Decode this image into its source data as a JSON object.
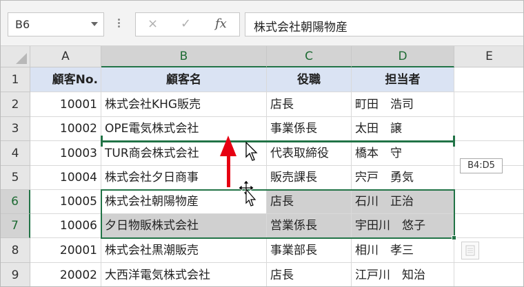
{
  "name_box": {
    "value": "B6"
  },
  "formula_bar": {
    "value": "株式会社朝陽物産",
    "cancel_icon": "×",
    "enter_icon": "✓",
    "fx_label": "fx"
  },
  "columns": [
    "A",
    "B",
    "C",
    "D",
    "E"
  ],
  "rows": [
    "1",
    "2",
    "3",
    "4",
    "5",
    "6",
    "7",
    "8",
    "9"
  ],
  "header_row": {
    "a": "顧客No.",
    "b": "顧客名",
    "c": "役職",
    "d": "担当者"
  },
  "data_rows": [
    {
      "a": "10001",
      "b": "株式会社KHG販売",
      "c": "店長",
      "d": "町田　浩司"
    },
    {
      "a": "10002",
      "b": "OPE電気株式会社",
      "c": "事業係長",
      "d": "太田　譲"
    },
    {
      "a": "10003",
      "b": "TUR商会株式会社",
      "c": "代表取締役",
      "d": "橋本　守"
    },
    {
      "a": "10004",
      "b": "株式会社夕日商事",
      "c": "販売課長",
      "d": "宍戸　勇気"
    },
    {
      "a": "10005",
      "b": "株式会社朝陽物産",
      "c": "店長",
      "d": "石川　正治"
    },
    {
      "a": "10006",
      "b": "夕日物販株式会社",
      "c": "営業係長",
      "d": "宇田川　悠子"
    },
    {
      "a": "20001",
      "b": "株式会社黒潮販売",
      "c": "事業部長",
      "d": "相川　孝三"
    },
    {
      "a": "20002",
      "b": "大西洋電気株式会社",
      "c": "店長",
      "d": "江戸川　知治"
    }
  ],
  "drag_tooltip": "B4:D5",
  "colors": {
    "selection": "#217346",
    "arrow": "#e60012",
    "header_fill": "#dae3f3",
    "dragged_fill": "#d0d0d0"
  }
}
